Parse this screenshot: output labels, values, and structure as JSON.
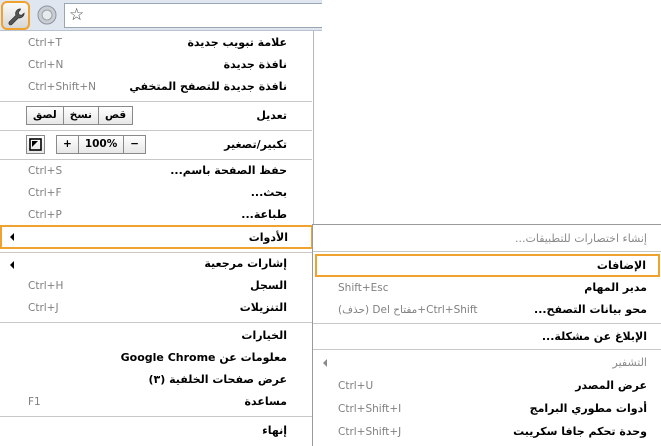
{
  "toolbar": {
    "wrench": "wrench-icon",
    "shield": "shield-icon",
    "star": "☆"
  },
  "menu": {
    "new_tab": {
      "label": "علامة تبويب جديدة",
      "shortcut": "Ctrl+T"
    },
    "new_window": {
      "label": "نافذة جديدة",
      "shortcut": "Ctrl+N"
    },
    "incognito": {
      "label": "نافذة جديدة للتصفح المتخفي",
      "shortcut": "Ctrl+Shift+N"
    },
    "edit": {
      "label": "تعديل",
      "cut": "قص",
      "copy": "نسخ",
      "paste": "لصق"
    },
    "zoom": {
      "label": "تكبير/تصغير",
      "minus": "−",
      "value": "100%",
      "plus": "+"
    },
    "save": {
      "label": "حفظ الصفحة باسم...",
      "shortcut": "Ctrl+S"
    },
    "find": {
      "label": "بحث...",
      "shortcut": "Ctrl+F"
    },
    "print": {
      "label": "طباعة...",
      "shortcut": "Ctrl+P"
    },
    "tools": {
      "label": "الأدوات"
    },
    "bookmarks": {
      "label": "إشارات مرجعية"
    },
    "history": {
      "label": "السجل",
      "shortcut": "Ctrl+H"
    },
    "downloads": {
      "label": "التنزيلات",
      "shortcut": "Ctrl+J"
    },
    "options": {
      "label": "الخيارات"
    },
    "about": {
      "label": "معلومات عن Google Chrome"
    },
    "background": {
      "label": "عرض صفحات الخلفية (٣)"
    },
    "help": {
      "label": "مساعدة",
      "shortcut": "F1"
    },
    "exit": {
      "label": "إنهاء"
    }
  },
  "submenu": {
    "app_shortcuts": {
      "label": "إنشاء اختصارات للتطبيقات..."
    },
    "extensions": {
      "label": "الإضافات"
    },
    "task_manager": {
      "label": "مدير المهام",
      "shortcut": "Shift+Esc"
    },
    "clear_data": {
      "label": "محو بيانات التصفح...",
      "shortcut": "Ctrl+Shift+مفتاح Del (حذف)"
    },
    "report": {
      "label": "الإبلاغ عن مشكلة..."
    },
    "encoding": {
      "label": "التشفير"
    },
    "view_source": {
      "label": "عرض المصدر",
      "shortcut": "Ctrl+U"
    },
    "dev_tools": {
      "label": "أدوات مطوري البرامج",
      "shortcut": "Ctrl+Shift+I"
    },
    "js_console": {
      "label": "وحدة تحكم جافا سكريبت",
      "shortcut": "Ctrl+Shift+J"
    }
  },
  "colors": {
    "highlight": "#f0a22e",
    "shortcut": "#808080",
    "separator": "#c8c8c8"
  }
}
